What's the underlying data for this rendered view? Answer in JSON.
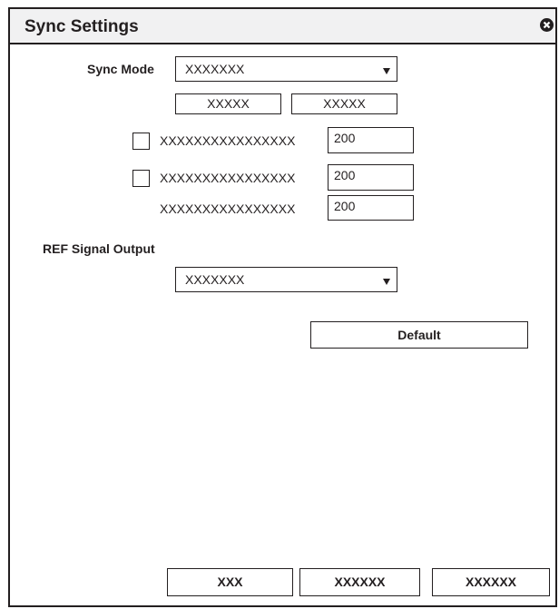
{
  "dialog": {
    "title": "Sync Settings"
  },
  "sync_mode": {
    "label": "Sync Mode",
    "selected": "XXXXXXX",
    "button_1": "XXXXX",
    "button_2": "XXXXX"
  },
  "rows": [
    {
      "checkbox": true,
      "label": "XXXXXXXXXXXXXXXX",
      "value": "200",
      "checked": false
    },
    {
      "checkbox": true,
      "label": "XXXXXXXXXXXXXXXX",
      "value": "200",
      "checked": false
    },
    {
      "checkbox": false,
      "label": "XXXXXXXXXXXXXXXX",
      "value": "200"
    }
  ],
  "ref_signal": {
    "label": "REF Signal Output",
    "selected": "XXXXXXX"
  },
  "default_button": "Default",
  "footer": {
    "ok": "XXX",
    "cancel": "XXXXXX",
    "apply": "XXXXXX"
  }
}
